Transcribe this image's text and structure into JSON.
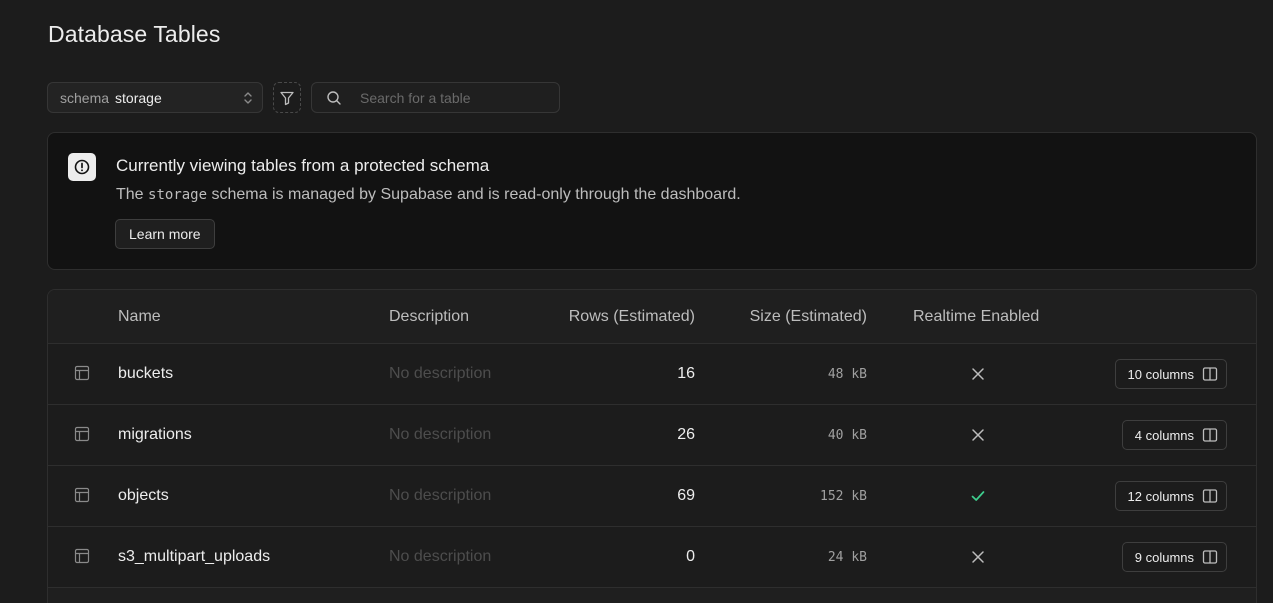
{
  "header": {
    "title": "Database Tables"
  },
  "toolbar": {
    "schema_label": "schema",
    "schema_value": "storage",
    "search_placeholder": "Search for a table"
  },
  "notice": {
    "heading": "Currently viewing tables from a protected schema",
    "body_prefix": "The",
    "body_code": "storage",
    "body_suffix": "schema is managed by Supabase and is read-only through the dashboard.",
    "button_label": "Learn more"
  },
  "table": {
    "columns": [
      "Name",
      "Description",
      "Rows (Estimated)",
      "Size (Estimated)",
      "Realtime Enabled"
    ],
    "rows": [
      {
        "name": "buckets",
        "description": "No description",
        "rows": "16",
        "size": "48 kB",
        "realtime": false,
        "columns_label": "10 columns"
      },
      {
        "name": "migrations",
        "description": "No description",
        "rows": "26",
        "size": "40 kB",
        "realtime": false,
        "columns_label": "4 columns"
      },
      {
        "name": "objects",
        "description": "No description",
        "rows": "69",
        "size": "152 kB",
        "realtime": true,
        "columns_label": "12 columns"
      },
      {
        "name": "s3_multipart_uploads",
        "description": "No description",
        "rows": "0",
        "size": "24 kB",
        "realtime": false,
        "columns_label": "9 columns"
      }
    ]
  },
  "colors": {
    "accent_green": "#3ecf8e",
    "background": "#1c1c1c"
  }
}
